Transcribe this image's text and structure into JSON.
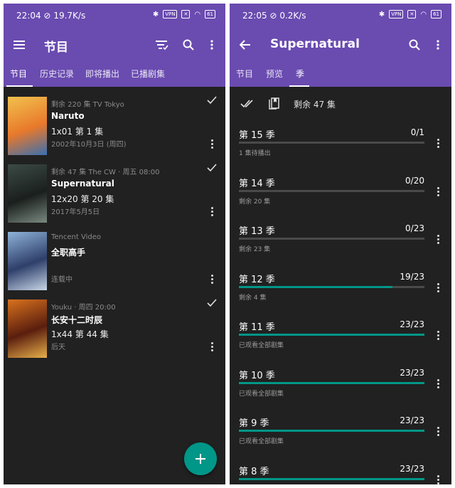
{
  "left": {
    "status": {
      "time": "22:04",
      "net": "19.7K/s",
      "battery": "61"
    },
    "title": "节目",
    "tabs": [
      "节目",
      "历史记录",
      "即将播出",
      "已播剧集"
    ],
    "shows": [
      {
        "sub": "剩余 220 集  TV Tokyo",
        "name": "Naruto",
        "ep": "1x01 第 1 集",
        "date": "2002年10月3日 (周四)",
        "watched": true,
        "poster_colors": [
          "#f2c14e",
          "#e8792b",
          "#3a6fb0"
        ]
      },
      {
        "sub": "剩余 47 集  The CW · 周五 08:00",
        "name": "Supernatural",
        "ep": "12x20 第 20 集",
        "date": "2017年5月5日",
        "watched": true,
        "poster_colors": [
          "#3c4b45",
          "#1a1f1d",
          "#7a8a80"
        ]
      },
      {
        "sub": "Tencent Video",
        "name": "全职高手",
        "ep": "",
        "date": "连载中",
        "watched": false,
        "poster_colors": [
          "#8fb3d9",
          "#2e3f6a",
          "#c9d7e8"
        ]
      },
      {
        "sub": "Youku · 周四 20:00",
        "name": "长安十二时辰",
        "ep": "1x44 第 44 集",
        "date": "后天",
        "watched": true,
        "poster_colors": [
          "#d9721e",
          "#5a1e0e",
          "#e8b04a"
        ]
      }
    ],
    "fab_icon": "add-icon"
  },
  "right": {
    "status": {
      "time": "22:05",
      "net": "0.2K/s",
      "battery": "61"
    },
    "title": "Supernatural",
    "tabs": [
      "节目",
      "预览",
      "季"
    ],
    "remaining": "剩余 47 集",
    "seasons": [
      {
        "name": "第 15 季",
        "progress": "0/1",
        "watched": 0,
        "total": 1,
        "status": "1 集待播出"
      },
      {
        "name": "第 14 季",
        "progress": "0/20",
        "watched": 0,
        "total": 20,
        "status": "剩余 20 集"
      },
      {
        "name": "第 13 季",
        "progress": "0/23",
        "watched": 0,
        "total": 23,
        "status": "剩余 23 集"
      },
      {
        "name": "第 12 季",
        "progress": "19/23",
        "watched": 19,
        "total": 23,
        "status": "剩余 4 集"
      },
      {
        "name": "第 11 季",
        "progress": "23/23",
        "watched": 23,
        "total": 23,
        "status": "已观看全部剧集"
      },
      {
        "name": "第 10 季",
        "progress": "23/23",
        "watched": 23,
        "total": 23,
        "status": "已观看全部剧集"
      },
      {
        "name": "第 9 季",
        "progress": "23/23",
        "watched": 23,
        "total": 23,
        "status": "已观看全部剧集"
      },
      {
        "name": "第 8 季",
        "progress": "23/23",
        "watched": 23,
        "total": 23,
        "status": ""
      }
    ]
  },
  "colors": {
    "primary": "#6a4bb0",
    "accent": "#009688",
    "background": "#212121"
  }
}
